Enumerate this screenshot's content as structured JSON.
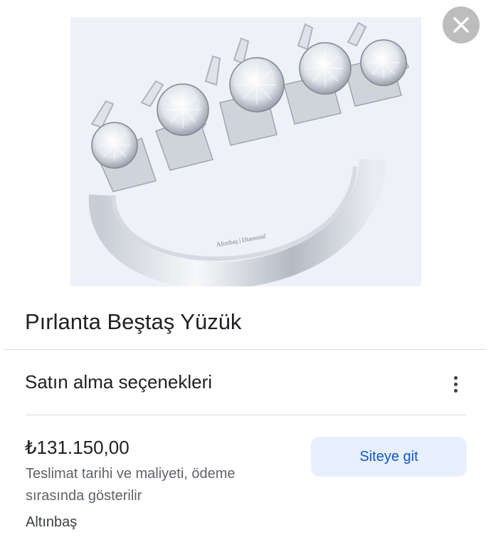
{
  "product": {
    "image_icon": "ring-image",
    "title": "Pırlanta Beştaş Yüzük",
    "engraving": "Altınbaş | Diamond"
  },
  "close_icon": "close-icon",
  "purchase": {
    "section_title": "Satın alma seçenekleri",
    "more_icon": "more-vert-icon",
    "price": "₺131.150,00",
    "delivery_note": "Teslimat tarihi ve maliyeti, ödeme sırasında gösterilir",
    "seller": "Altınbaş",
    "site_button": "Siteye git"
  },
  "colors": {
    "accent": "#0b57d0",
    "button_bg": "#e8f0fe",
    "close_bg": "#bdbdbd"
  }
}
